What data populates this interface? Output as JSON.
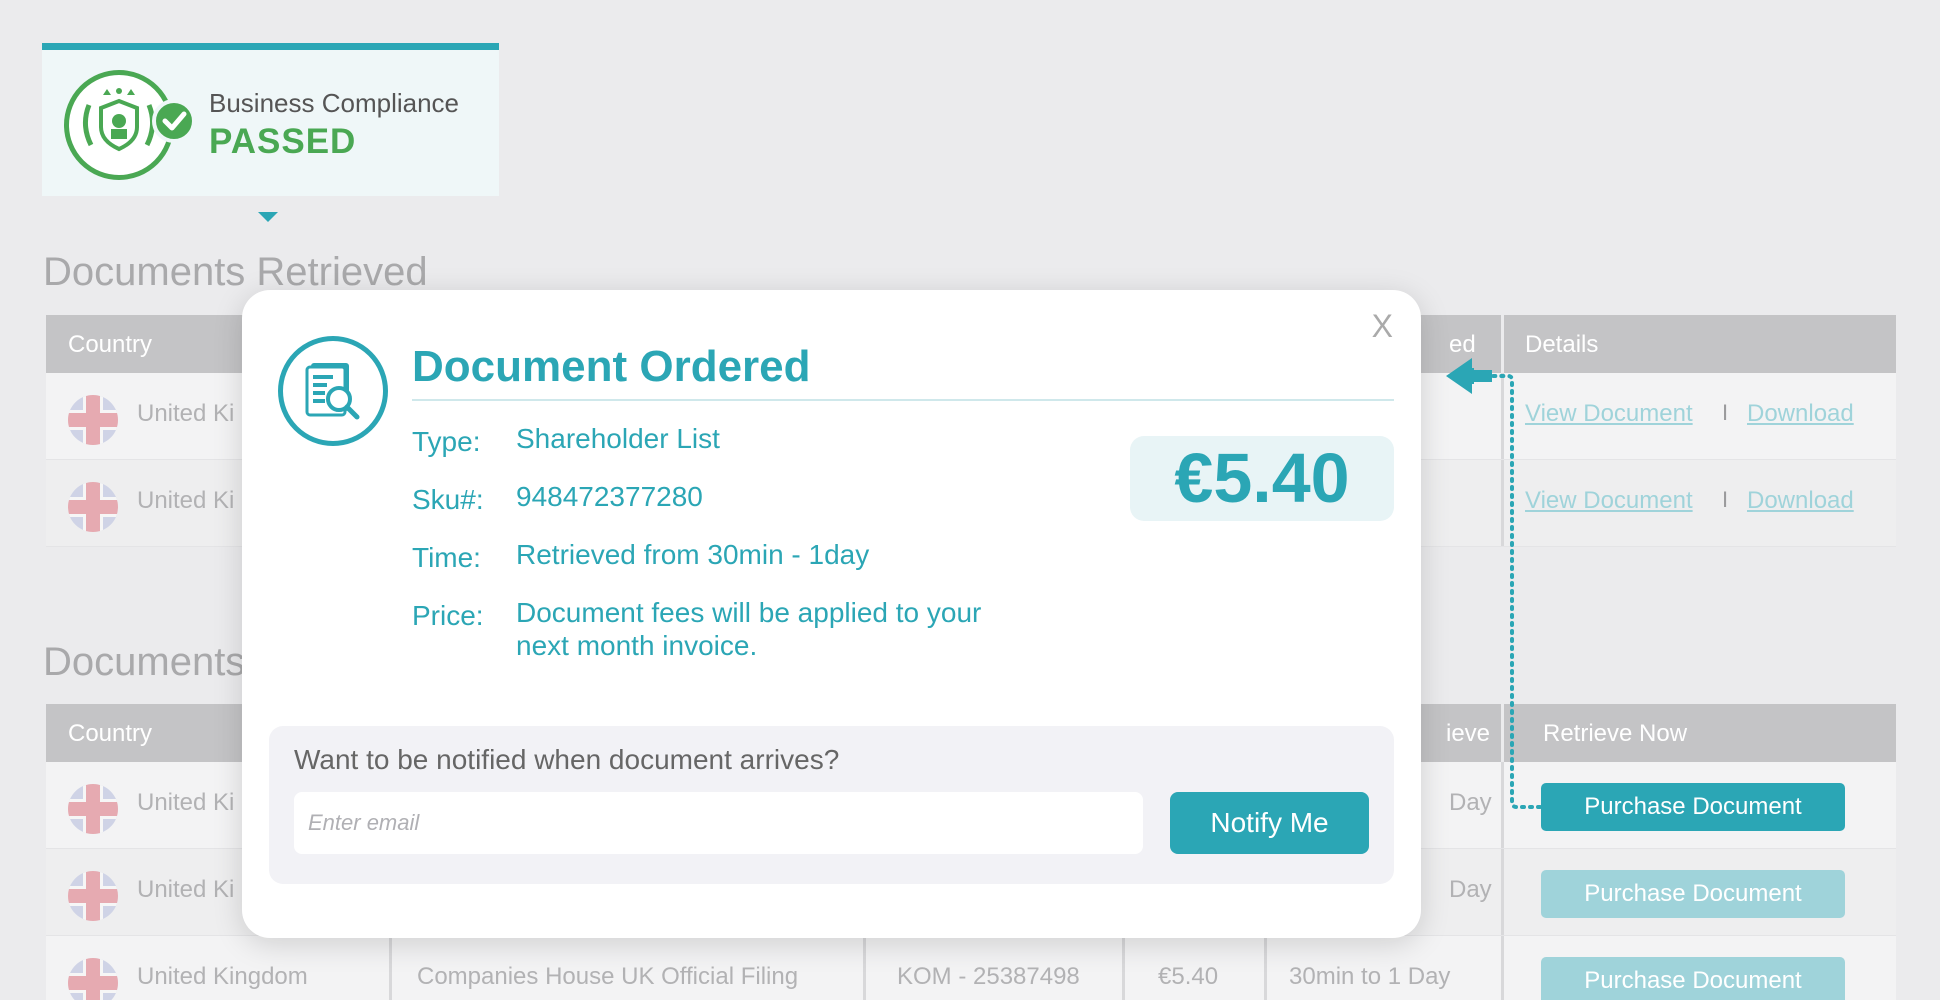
{
  "compliance": {
    "label": "Business Compliance",
    "status": "PASSED"
  },
  "sections": {
    "retrieved_title": "Documents Retrieved",
    "second_title": "Documents"
  },
  "retrieved_table": {
    "headers": {
      "country": "Country",
      "ved_partial": "ed",
      "details": "Details"
    },
    "rows": [
      {
        "country": "United Ki",
        "view": "View Document",
        "sep": "I",
        "download": "Download"
      },
      {
        "country": "United Ki",
        "view": "View Document",
        "sep": "I",
        "download": "Download"
      }
    ]
  },
  "available_table": {
    "headers": {
      "country": "Country",
      "retrieve_partial": "ieve",
      "retrieve_now": "Retrieve Now"
    },
    "rows": [
      {
        "country": "United Ki",
        "time_partial": "Day",
        "action": "Purchase Document"
      },
      {
        "country": "United Ki",
        "time_partial": "Day",
        "action": "Purchase Document"
      },
      {
        "country": "United Kingdom",
        "source": "Companies House UK Official Filing",
        "sku": "KOM - 25387498",
        "price": "€5.40",
        "time": "30min to 1 Day",
        "action": "Purchase Document"
      }
    ]
  },
  "modal": {
    "close": "X",
    "title": "Document Ordered",
    "type_label": "Type:",
    "type_value": "Shareholder List",
    "sku_label": "Sku#:",
    "sku_value": "948472377280",
    "time_label": "Time:",
    "time_value": "Retrieved from 30min - 1day",
    "price_label": "Price:",
    "price_value": "Document fees will be applied to your next month invoice.",
    "price_amount": "€5.40",
    "notify_question": "Want to be notified when document arrives?",
    "email_placeholder": "Enter email",
    "notify_button": "Notify Me"
  },
  "colors": {
    "accent": "#2ba6b5",
    "success": "#4aa853",
    "faded_accent": "#9fd3da"
  },
  "icons": [
    "compliance-seal-icon",
    "check-icon",
    "document-search-icon",
    "uk-flag-icon",
    "arrow-left-icon"
  ]
}
